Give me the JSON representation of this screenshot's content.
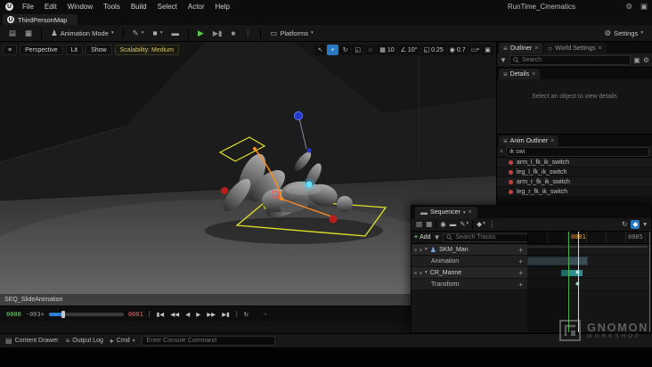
{
  "window": {
    "title": "RunTime_Cinematics"
  },
  "menu": {
    "items": [
      "File",
      "Edit",
      "Window",
      "Tools",
      "Build",
      "Select",
      "Actor",
      "Help"
    ]
  },
  "tabs": {
    "level_tab": "ThirdPersonMap"
  },
  "toolbar": {
    "mode": "Animation Mode",
    "platforms": "Platforms",
    "settings": "Settings"
  },
  "viewport": {
    "buttons": {
      "perspective": "Perspective",
      "lit": "Lit",
      "show": "Show"
    },
    "scalability": "Scalability: Medium",
    "snaps": {
      "grid": "10",
      "rotation": "10°",
      "scale": "0.25",
      "speed": "0.7"
    },
    "sequence_name": "SEQ_SlideAnimation",
    "transport": {
      "start": "0000",
      "offset": "-003+",
      "current": "0001"
    }
  },
  "outliner": {
    "tab": "Outliner",
    "world_tab": "World Settings",
    "search_placeholder": "Search"
  },
  "details": {
    "tab": "Details",
    "empty": "Select an object to view details"
  },
  "anim_outliner": {
    "tab": "Anim Outliner",
    "search_value": "ik swi",
    "items": [
      "arm_l_fk_ik_switch",
      "leg_l_fk_ik_switch",
      "arm_r_fk_ik_switch",
      "leg_r_fk_ik_switch"
    ]
  },
  "sequencer": {
    "tab": "Sequencer",
    "add": "Add",
    "search_placeholder": "Search Tracks",
    "current_frame": "0001",
    "end_frame": "0005",
    "tracks": [
      "SKM_Man",
      "Animation",
      "CR_Manne",
      "Transform"
    ]
  },
  "statusbar": {
    "content_drawer": "Content Drawer",
    "output_log": "Output Log",
    "cmd": "Cmd",
    "console_placeholder": "Enter Console Command"
  },
  "watermark": {
    "name": "GNOMON",
    "sub": "WORKSHOP"
  },
  "colors": {
    "accent": "#2a78c2",
    "play_green": "#58c64e",
    "key_red": "#c24040",
    "frame_orange": "#e8a33d",
    "range_green": "#4caf50",
    "range_red": "#e53935"
  },
  "icons": {
    "ue_logo": "U",
    "caret": "▾",
    "caret_right": "▸",
    "close": "×",
    "menu": "≡",
    "gear": "⚙",
    "grid": "▦",
    "layout": "▣",
    "save": "▤",
    "camera": "◉",
    "clapper": "▬",
    "pencil": "✎",
    "dots": "⋯",
    "vdots": "⋮",
    "diamond": "◆",
    "loop": "↻",
    "arrow_right": "→",
    "plus": "+",
    "play": "▶",
    "stop": "■",
    "step_fwd": "▶▮",
    "person": "♟",
    "cube": "■",
    "globe": "○",
    "cursor": "↖",
    "move": "+",
    "rotate": "↻",
    "scale": "◱",
    "angle": "∠",
    "monitor": "▭",
    "bracket_l": "[",
    "bracket_r": "]",
    "jump_start": "▮◀",
    "back_fast": "◀◀",
    "back": "◀",
    "fwd_fast": "▶▶",
    "jump_end": "▶▮",
    "filter": "▼",
    "folder": "▣",
    "dot": "●"
  }
}
